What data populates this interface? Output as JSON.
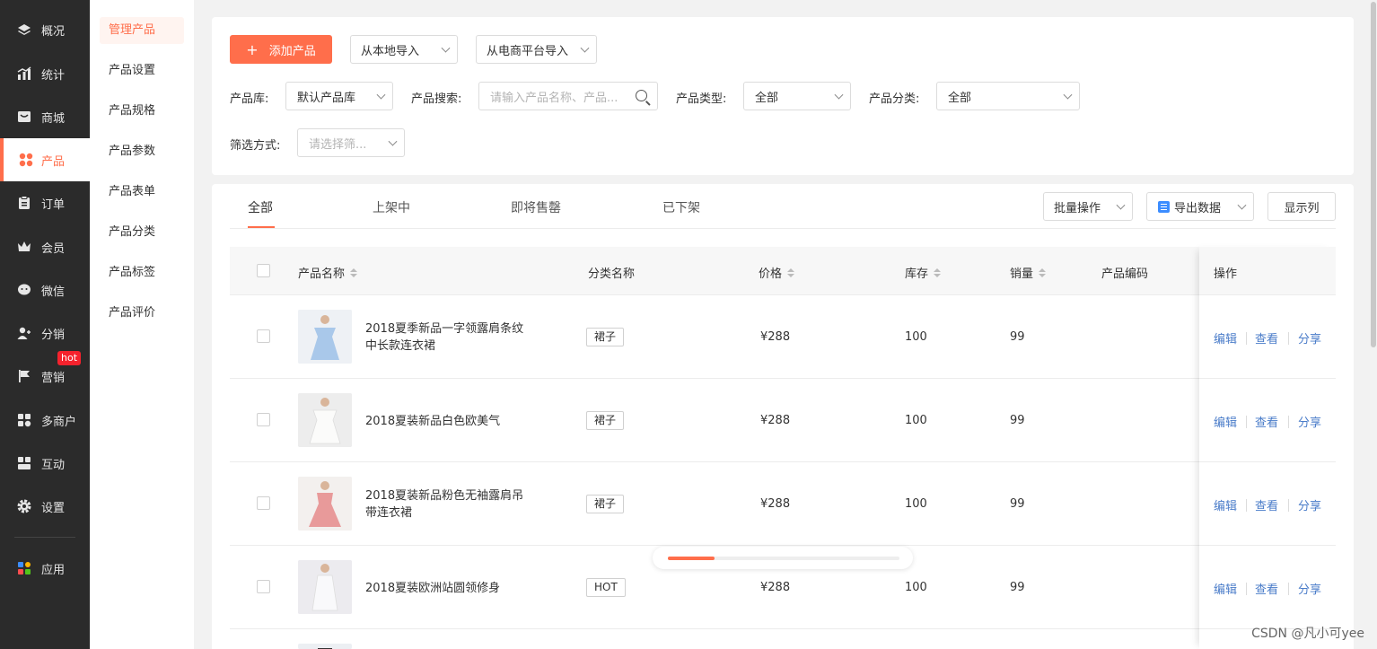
{
  "nav": {
    "items": [
      {
        "label": "概况",
        "icon": "layers-icon"
      },
      {
        "label": "统计",
        "icon": "chart-icon"
      },
      {
        "label": "商城",
        "icon": "store-icon"
      },
      {
        "label": "产品",
        "icon": "grid-icon",
        "active": true
      },
      {
        "label": "订单",
        "icon": "clipboard-icon"
      },
      {
        "label": "会员",
        "icon": "crown-icon"
      },
      {
        "label": "微信",
        "icon": "wechat-icon"
      },
      {
        "label": "分销",
        "icon": "people-icon"
      },
      {
        "label": "营销",
        "icon": "flag-icon"
      },
      {
        "label": "多商户",
        "icon": "merchant-icon"
      },
      {
        "label": "互动",
        "icon": "interact-icon"
      },
      {
        "label": "设置",
        "icon": "gear-icon"
      },
      {
        "label": "应用",
        "icon": "apps-icon"
      }
    ],
    "hot_badge": "hot",
    "accent": "#ff6e4b"
  },
  "submenu": {
    "items": [
      "管理产品",
      "产品设置",
      "产品规格",
      "产品参数",
      "产品表单",
      "产品分类",
      "产品标签",
      "产品评价"
    ]
  },
  "toolbar": {
    "add_label": "添加产品",
    "add_icon": "+",
    "import_local": "从本地导入",
    "import_ecommerce": "从电商平台导入"
  },
  "filters": {
    "library_label": "产品库:",
    "library_value": "默认产品库",
    "search_label": "产品搜索:",
    "search_placeholder": "请输入产品名称、产品...",
    "type_label": "产品类型:",
    "type_value": "全部",
    "category_label": "产品分类:",
    "category_value": "全部",
    "filter_label": "筛选方式:",
    "filter_placeholder": "请选择筛..."
  },
  "tabs": [
    "全部",
    "上架中",
    "即将售罄",
    "已下架"
  ],
  "actions": {
    "batch": "批量操作",
    "export": "导出数据",
    "columns": "显示列"
  },
  "table": {
    "headers": {
      "name": "产品名称",
      "category": "分类名称",
      "price": "价格",
      "stock": "库存",
      "sales": "销量",
      "code": "产品编码",
      "ops": "操作"
    },
    "rows": [
      {
        "name": "2018夏季新品一字领露肩条纹中长款连衣裙",
        "name_l1": "2018夏季新品一字领露肩条纹",
        "name_l2": "中长款连衣裙",
        "tag": "裙子",
        "price": "¥288",
        "stock": "100",
        "sales": "99",
        "thumb_color": "#a9c8ea"
      },
      {
        "name": "2018夏装新品白色欧美气",
        "name_l1": "2018夏装新品白色欧美气",
        "name_l2": "",
        "tag": "裙子",
        "price": "¥288",
        "stock": "100",
        "sales": "99",
        "thumb_color": "#f4f4f2"
      },
      {
        "name": "2018夏装新品粉色无袖露肩吊带连衣裙",
        "name_l1": "2018夏装新品粉色无袖露肩吊",
        "name_l2": "带连衣裙",
        "tag": "裙子",
        "price": "¥288",
        "stock": "100",
        "sales": "99",
        "thumb_color": "#e89a9a"
      },
      {
        "name": "2018夏装欧洲站圆领修身",
        "name_l1": "2018夏装欧洲站圆领修身",
        "name_l2": "",
        "tag": "HOT",
        "price": "¥288",
        "stock": "100",
        "sales": "99",
        "thumb_color": "#f2f2f4"
      }
    ],
    "ops": {
      "edit": "编辑",
      "view": "查看",
      "share": "分享"
    }
  },
  "scroll_progress": 0.2,
  "watermark": "CSDN @凡小可yee"
}
